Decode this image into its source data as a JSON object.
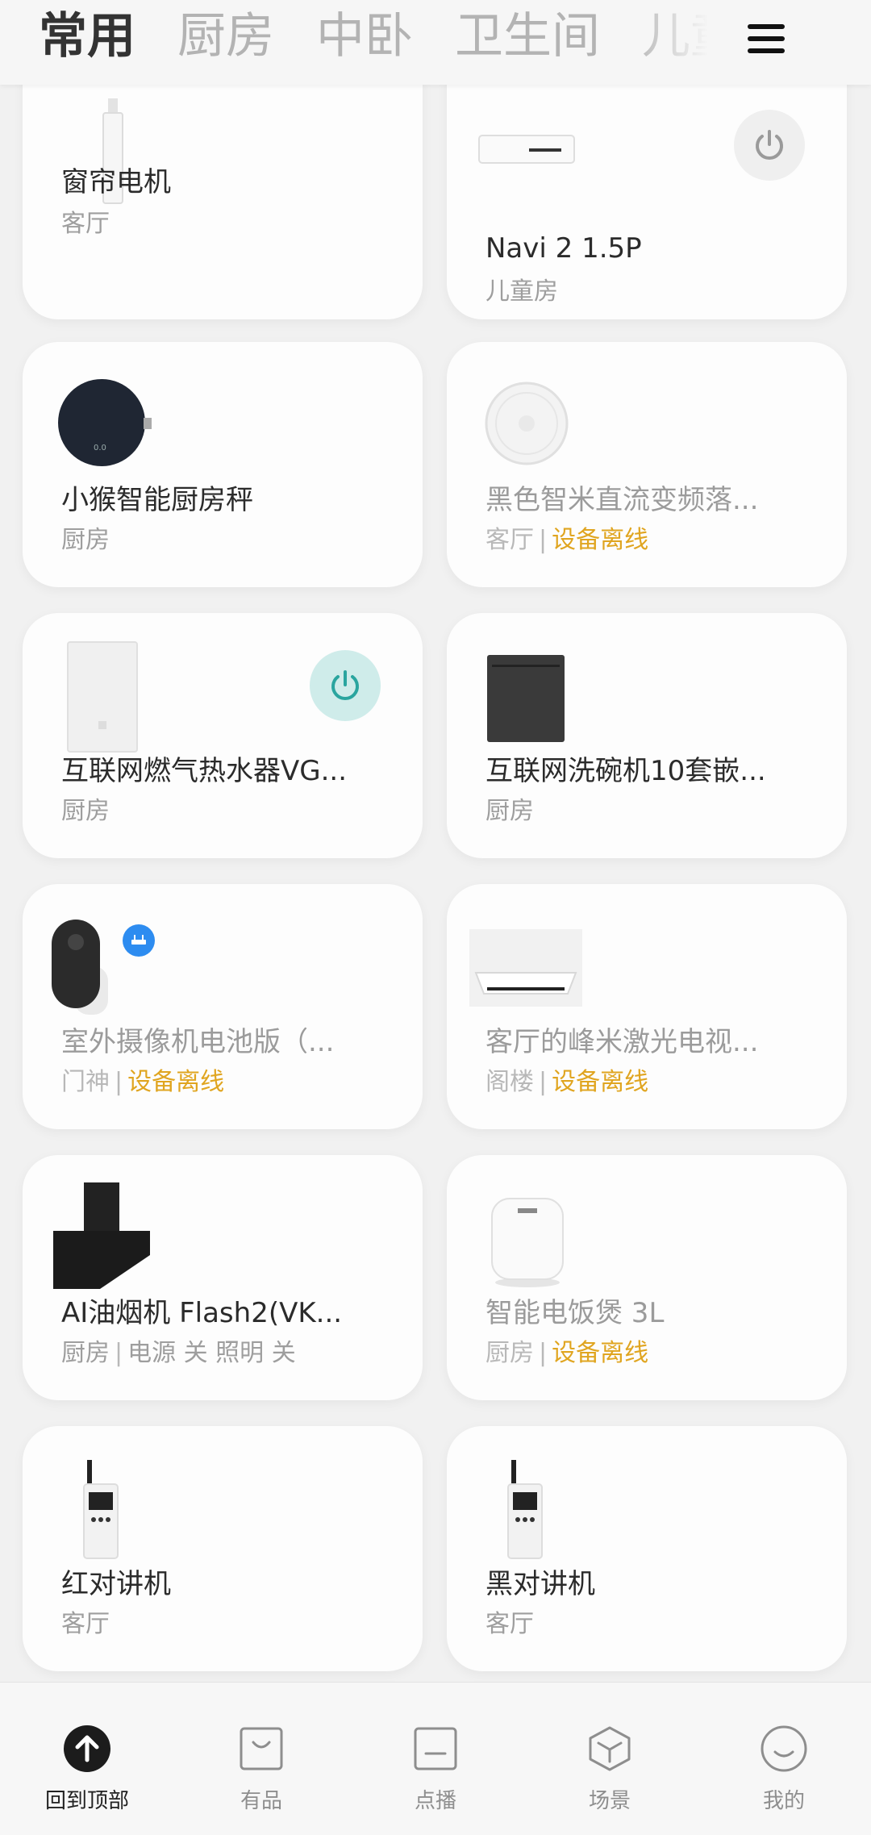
{
  "tabs": [
    "常用",
    "厨房",
    "中卧",
    "卫生间",
    "儿童房"
  ],
  "active_tab": "常用",
  "devices": [
    {
      "name": "窗帘电机",
      "room": "客厅"
    },
    {
      "name": "Navi 2 1.5P",
      "room": "儿童房"
    },
    {
      "name": "小猴智能厨房秤",
      "room": "厨房"
    },
    {
      "name": "黑色智米直流变频落...",
      "room": "客厅",
      "status": "设备离线"
    },
    {
      "name": "互联网燃气热水器VG...",
      "room": "厨房"
    },
    {
      "name": "互联网洗碗机10套嵌...",
      "room": "厨房"
    },
    {
      "name": "室外摄像机电池版（...",
      "room": "门神",
      "status": "设备离线"
    },
    {
      "name": "客厅的峰米激光电视...",
      "room": "阁楼",
      "status": "设备离线"
    },
    {
      "name": "AI油烟机 Flash2(VK...",
      "room": "厨房",
      "state": "电源 关 照明 关"
    },
    {
      "name": "智能电饭煲 3L",
      "room": "厨房",
      "status": "设备离线"
    },
    {
      "name": "红对讲机",
      "room": "客厅"
    },
    {
      "name": "黑对讲机",
      "room": "客厅"
    }
  ],
  "separator": "|",
  "colors": {
    "offline": "#e0a520",
    "power_on": "#2aa59f",
    "power_bg_on": "#cfecea"
  },
  "bottom_nav": [
    {
      "label": "回到顶部",
      "icon": "arrow-up-icon"
    },
    {
      "label": "有品",
      "icon": "shopping-bag-icon"
    },
    {
      "label": "点播",
      "icon": "tv-icon"
    },
    {
      "label": "场景",
      "icon": "cube-icon"
    },
    {
      "label": "我的",
      "icon": "smile-icon"
    }
  ]
}
